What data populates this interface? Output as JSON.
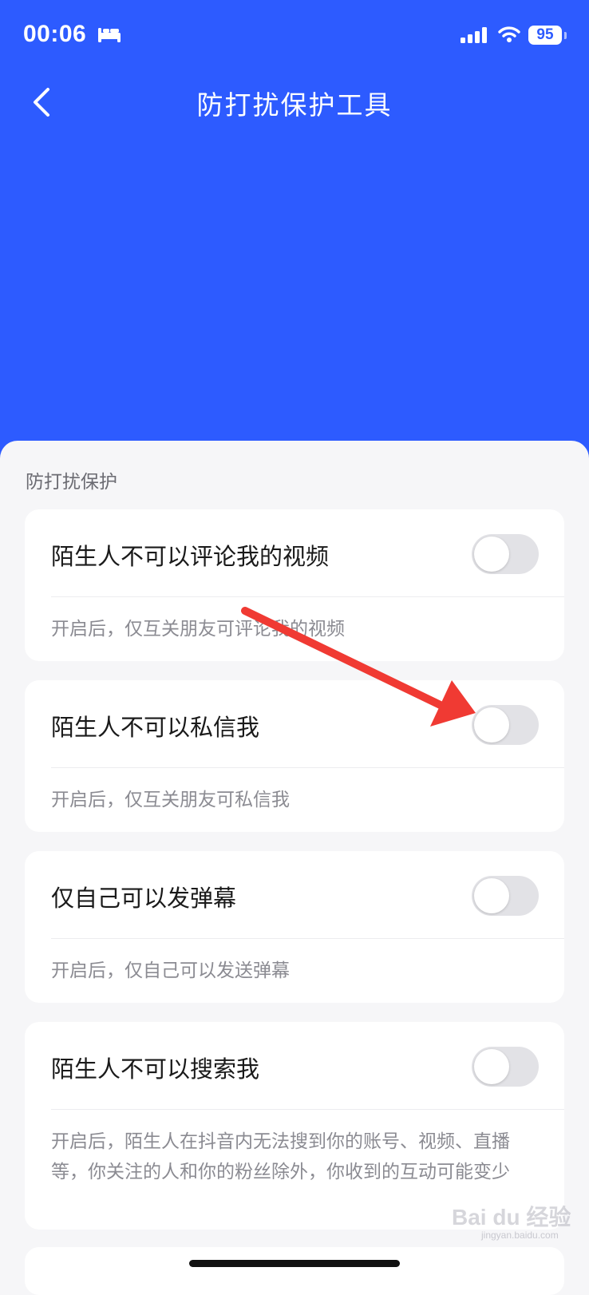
{
  "status_bar": {
    "time": "00:06",
    "battery": "95",
    "icons": [
      "bed-icon",
      "signal-icon",
      "wifi-icon",
      "battery-icon"
    ]
  },
  "header": {
    "title": "防打扰保护工具",
    "back_icon": "chevron-left-icon",
    "background_color": "#2d5bff"
  },
  "section": {
    "title": "防打扰保护"
  },
  "settings": [
    {
      "label": "陌生人不可以评论我的视频",
      "description": "开启后，仅互关朋友可评论我的视频",
      "enabled": false
    },
    {
      "label": "陌生人不可以私信我",
      "description": "开启后，仅互关朋友可私信我",
      "enabled": false
    },
    {
      "label": "仅自己可以发弹幕",
      "description": "开启后，仅自己可以发送弹幕",
      "enabled": false
    },
    {
      "label": "陌生人不可以搜索我",
      "description": "开启后，陌生人在抖音内无法搜到你的账号、视频、直播等，你关注的人和你的粉丝除外，你收到的互动可能变少",
      "enabled": false
    }
  ],
  "annotation": {
    "type": "red-arrow",
    "color": "#f03a33"
  },
  "watermark": {
    "text": "Bai du 经验",
    "subtext": "jingyan.baidu.com"
  }
}
